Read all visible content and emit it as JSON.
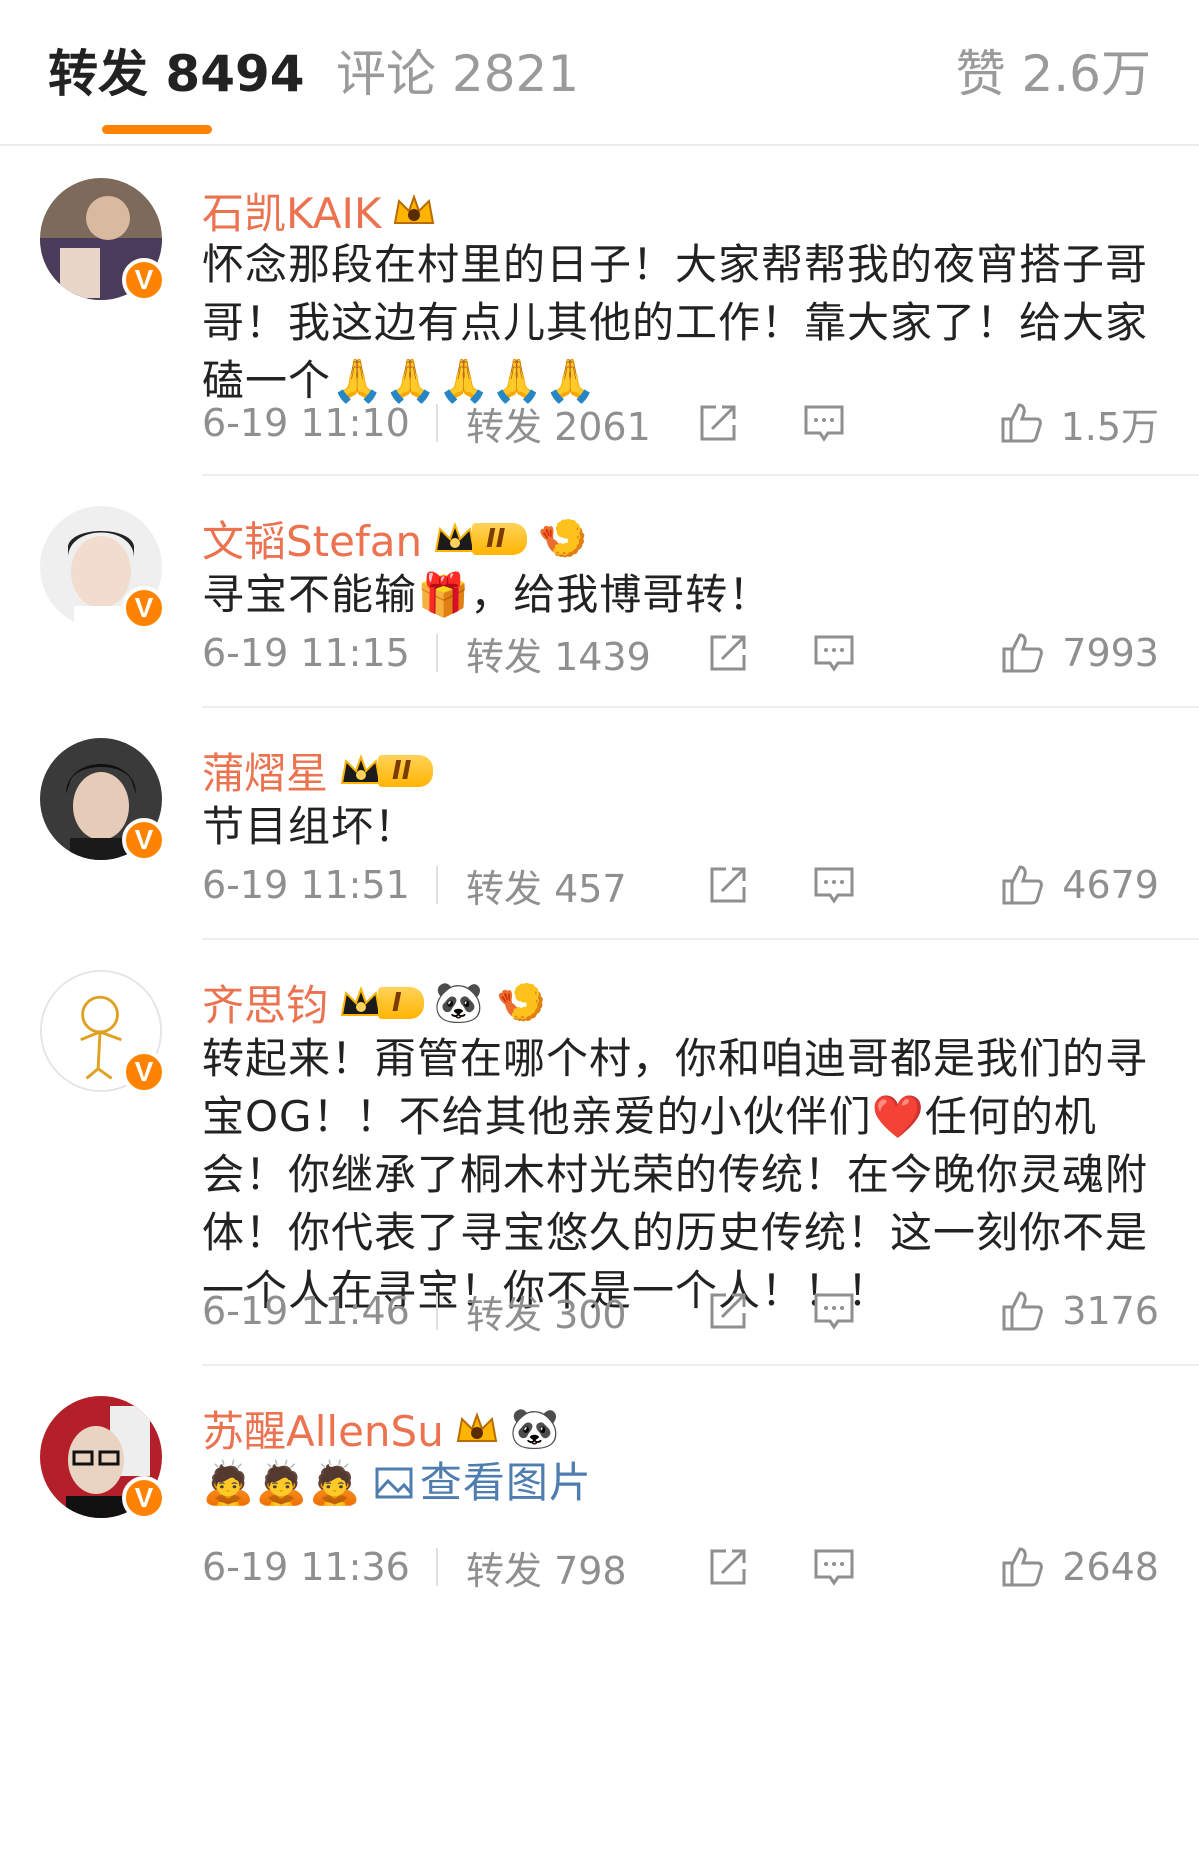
{
  "tabs": {
    "repost": "转发 8494",
    "comment": "评论 2821",
    "like": "赞 2.6万"
  },
  "comments": [
    {
      "name": "石凯KAIK",
      "text": "怀念那段在村里的日子！大家帮帮我的夜宵搭子哥哥！我这边有点儿其他的工作！靠大家了！给大家磕一个🙏🙏🙏🙏🙏",
      "time": "6-19 11:10",
      "repost": "转发 2061",
      "likes": "1.5万"
    },
    {
      "name": "文韬Stefan",
      "level": "II",
      "emoji": "🍤",
      "text": "寻宝不能输🎁，给我博哥转！",
      "time": "6-19 11:15",
      "repost": "转发 1439",
      "likes": "7993"
    },
    {
      "name": "蒲熠星",
      "level": "II",
      "text": "节目组坏！",
      "time": "6-19 11:51",
      "repost": "转发 457",
      "likes": "4679"
    },
    {
      "name": "齐思钧",
      "level": "I",
      "emoji": "🐼 🍤",
      "text": "转起来！甭管在哪个村，你和咱迪哥都是我们的寻宝OG！！不给其他亲爱的小伙伴们❤️任何的机会！你继承了桐木村光荣的传统！在今晚你灵魂附体！你代表了寻宝悠久的历史传统！这一刻你不是一个人在寻宝！你不是一个人！！！",
      "time": "6-19 11:46",
      "repost": "转发 300",
      "likes": "3176"
    },
    {
      "name": "苏醒AllenSu",
      "emoji": "🐼",
      "text": "🙇🙇🙇",
      "link": "查看图片",
      "time": "6-19 11:36",
      "repost": "转发 798",
      "likes": "2648"
    }
  ],
  "colors": {
    "accent": "#ff8200",
    "username": "#eb7350",
    "link": "#507daf",
    "meta": "#8f8f8f"
  },
  "icons": [
    "share-icon",
    "comment-icon",
    "like-thumb-icon",
    "verified-v-icon",
    "crown-icon",
    "image-icon"
  ]
}
